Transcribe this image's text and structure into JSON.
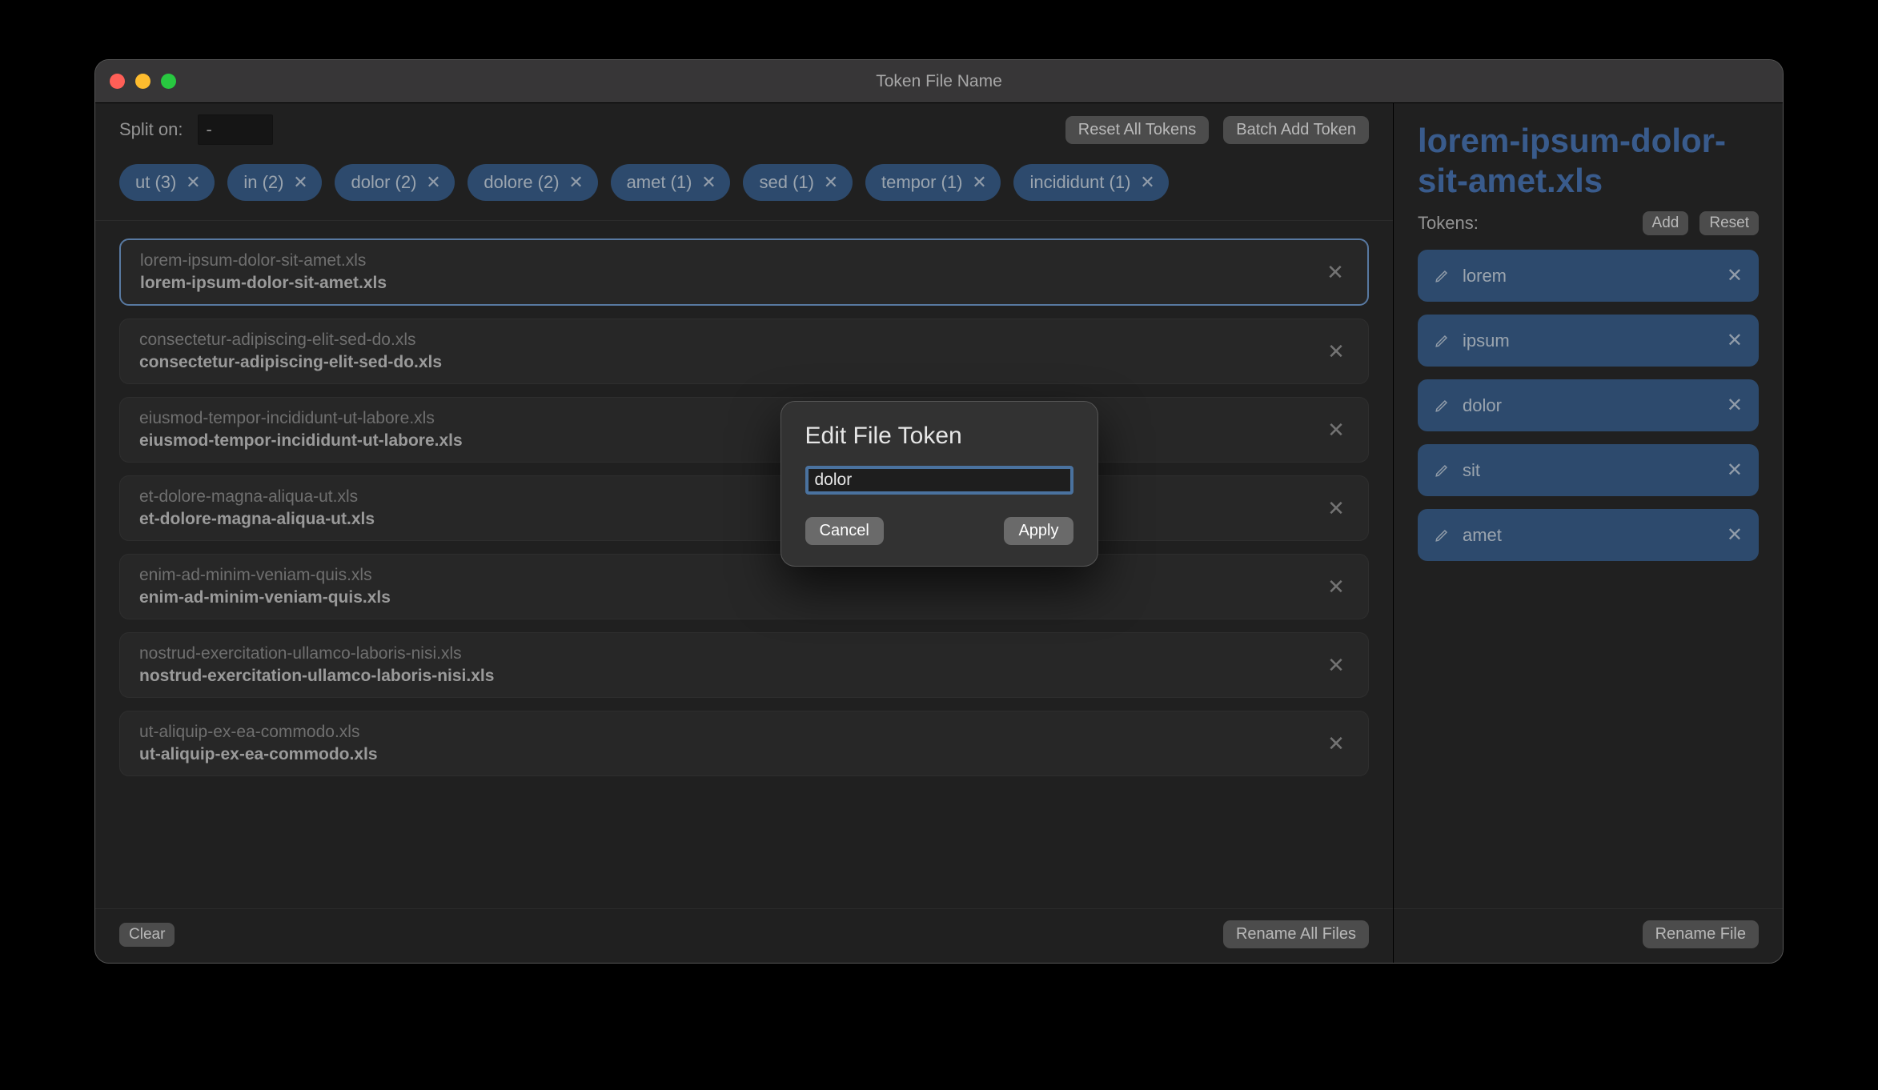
{
  "window_title": "Token File Name",
  "toolbar": {
    "split_label": "Split on:",
    "split_value": "-",
    "reset_all_tokens": "Reset All Tokens",
    "batch_add_token": "Batch Add Token"
  },
  "chips": [
    {
      "label": "ut (3)"
    },
    {
      "label": "in (2)"
    },
    {
      "label": "dolor (2)"
    },
    {
      "label": "dolore (2)"
    },
    {
      "label": "amet (1)"
    },
    {
      "label": "sed (1)"
    },
    {
      "label": "tempor (1)"
    },
    {
      "label": "incididunt (1)"
    }
  ],
  "files": [
    {
      "orig": "lorem-ipsum-dolor-sit-amet.xls",
      "new": "lorem-ipsum-dolor-sit-amet.xls",
      "selected": true
    },
    {
      "orig": "consectetur-adipiscing-elit-sed-do.xls",
      "new": "consectetur-adipiscing-elit-sed-do.xls",
      "selected": false
    },
    {
      "orig": "eiusmod-tempor-incididunt-ut-labore.xls",
      "new": "eiusmod-tempor-incididunt-ut-labore.xls",
      "selected": false
    },
    {
      "orig": "et-dolore-magna-aliqua-ut.xls",
      "new": "et-dolore-magna-aliqua-ut.xls",
      "selected": false
    },
    {
      "orig": "enim-ad-minim-veniam-quis.xls",
      "new": "enim-ad-minim-veniam-quis.xls",
      "selected": false
    },
    {
      "orig": "nostrud-exercitation-ullamco-laboris-nisi.xls",
      "new": "nostrud-exercitation-ullamco-laboris-nisi.xls",
      "selected": false
    },
    {
      "orig": "ut-aliquip-ex-ea-commodo.xls",
      "new": "ut-aliquip-ex-ea-commodo.xls",
      "selected": false
    }
  ],
  "bottom_left": {
    "clear": "Clear",
    "rename_all": "Rename All Files"
  },
  "right": {
    "filename_preview": "lorem-ipsum-dolor-sit-amet.xls",
    "tokens_label": "Tokens:",
    "add_label": "Add",
    "reset_label": "Reset",
    "tokens": [
      {
        "label": "lorem"
      },
      {
        "label": "ipsum"
      },
      {
        "label": "dolor"
      },
      {
        "label": "sit"
      },
      {
        "label": "amet"
      }
    ],
    "rename_file": "Rename File"
  },
  "modal": {
    "title": "Edit File Token",
    "value": "dolor",
    "cancel": "Cancel",
    "apply": "Apply"
  }
}
